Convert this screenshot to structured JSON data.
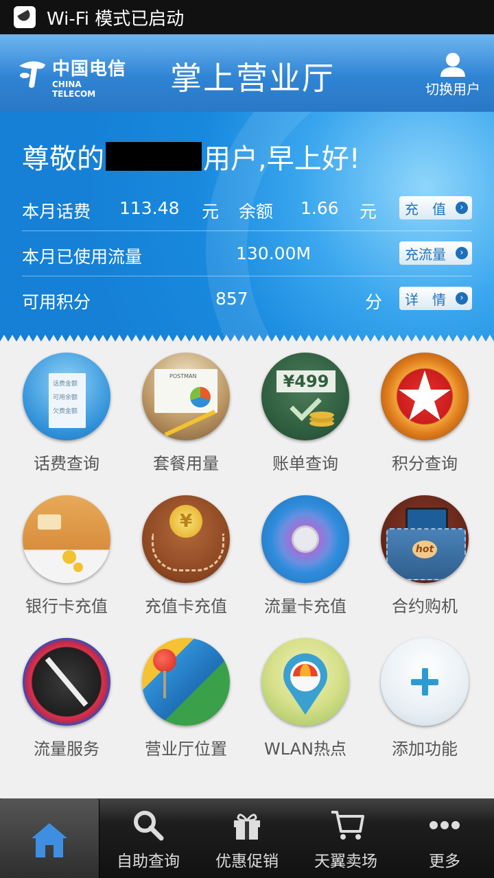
{
  "status_bar": {
    "text": "Wi-Fi 模式已启动"
  },
  "header": {
    "logo_cn": "中国电信",
    "logo_en": "CHINA TELECOM",
    "title": "掌上营业厅",
    "switch_user_label": "切换用户"
  },
  "account": {
    "greeting_prefix": "尊敬的",
    "greeting_suffix": "用户,早上好!",
    "bill_label": "本月话费",
    "bill_value": "113.48",
    "bill_unit": "元",
    "balance_label": "余额",
    "balance_value": "1.66",
    "balance_unit": "元",
    "recharge_button": "充　值",
    "data_label": "本月已使用流量",
    "data_value": "130.00M",
    "data_button": "充流量",
    "points_label": "可用积分",
    "points_value": "857",
    "points_unit": "分",
    "points_button": "详　情"
  },
  "features": [
    {
      "label": "话费查询"
    },
    {
      "label": "套餐用量"
    },
    {
      "label": "账单查询"
    },
    {
      "label": "积分查询"
    },
    {
      "label": "银行卡充值"
    },
    {
      "label": "充值卡充值"
    },
    {
      "label": "流量卡充值"
    },
    {
      "label": "合约购机"
    },
    {
      "label": "流量服务"
    },
    {
      "label": "营业厅位置"
    },
    {
      "label": "WLAN热点"
    },
    {
      "label": "添加功能"
    }
  ],
  "icon_text": {
    "bill_lines": [
      "话费金额",
      "可用余额",
      "欠费金额"
    ],
    "package_card": "POSTMAN",
    "bill_amount": "¥499",
    "hot": "hot"
  },
  "tabs": [
    {
      "label": "",
      "icon": "home-icon"
    },
    {
      "label": "自助查询",
      "icon": "search-icon"
    },
    {
      "label": "优惠促销",
      "icon": "gift-icon"
    },
    {
      "label": "天翼卖场",
      "icon": "cart-icon"
    },
    {
      "label": "更多",
      "icon": "more-icon"
    }
  ],
  "colors": {
    "header": "#2f84d4",
    "panel": "#1889de",
    "accent": "#1f73bc"
  }
}
